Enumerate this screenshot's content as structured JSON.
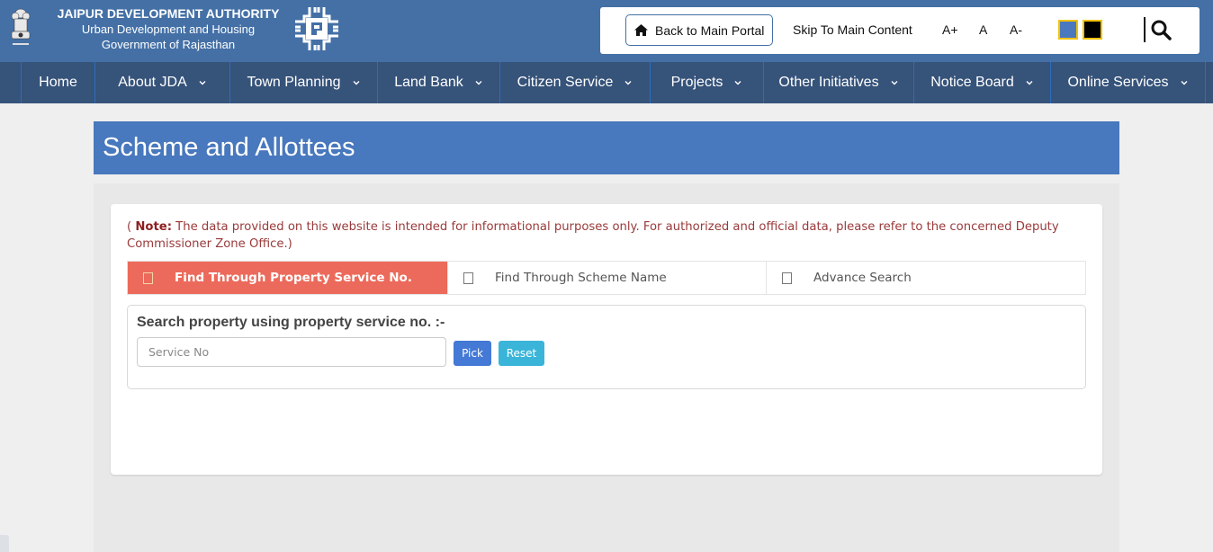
{
  "header": {
    "org_name": "JAIPUR DEVELOPMENT AUTHORITY",
    "dept": "Urban Development and Housing",
    "govt": "Government of Rajasthan",
    "emblem_icon": "state-emblem-icon",
    "logo_icon": "jda-logo-icon"
  },
  "topbar": {
    "back_label": "Back to Main Portal",
    "back_icon": "home-icon",
    "skip_label": "Skip To Main Content",
    "font_increase": "A+",
    "font_normal": "A",
    "font_decrease": "A-",
    "themes": [
      {
        "name": "blue-theme",
        "color": "#4a78be"
      },
      {
        "name": "dark-theme",
        "color": "#000000"
      }
    ],
    "search_icon": "search-icon"
  },
  "nav": {
    "items": [
      {
        "label": "Home",
        "dropdown": false
      },
      {
        "label": "About JDA",
        "dropdown": true
      },
      {
        "label": "Town Planning",
        "dropdown": true
      },
      {
        "label": "Land Bank",
        "dropdown": true
      },
      {
        "label": "Citizen Service",
        "dropdown": true
      },
      {
        "label": "Projects",
        "dropdown": true
      },
      {
        "label": "Other Initiatives",
        "dropdown": true
      },
      {
        "label": "Notice Board",
        "dropdown": true
      },
      {
        "label": "Online Services",
        "dropdown": true
      }
    ]
  },
  "page": {
    "title": "Scheme and Allottees",
    "note_open": "( ",
    "note_label": "Note:",
    "note_text": " The data provided on this website is intended for informational purposes only. For authorized and official data, please refer to the concerned Deputy Commissioner Zone Office.)",
    "tabs": [
      {
        "label": "Find Through Property Service No.",
        "active": true
      },
      {
        "label": "Find Through Scheme Name",
        "active": false
      },
      {
        "label": "Advance Search",
        "active": false
      }
    ],
    "search": {
      "heading": "Search property using property service no. :-",
      "input_value": "",
      "input_placeholder": "Service No",
      "pick_label": "Pick",
      "reset_label": "Reset"
    }
  },
  "colors": {
    "header_bg": "#4470a6",
    "nav_bg": "#36537a",
    "title_bg": "#4878bd",
    "active_tab": "#ec6a5b",
    "pick_btn": "#4479d6",
    "reset_btn": "#3ab5d9",
    "note_text": "#9a3a3a"
  }
}
